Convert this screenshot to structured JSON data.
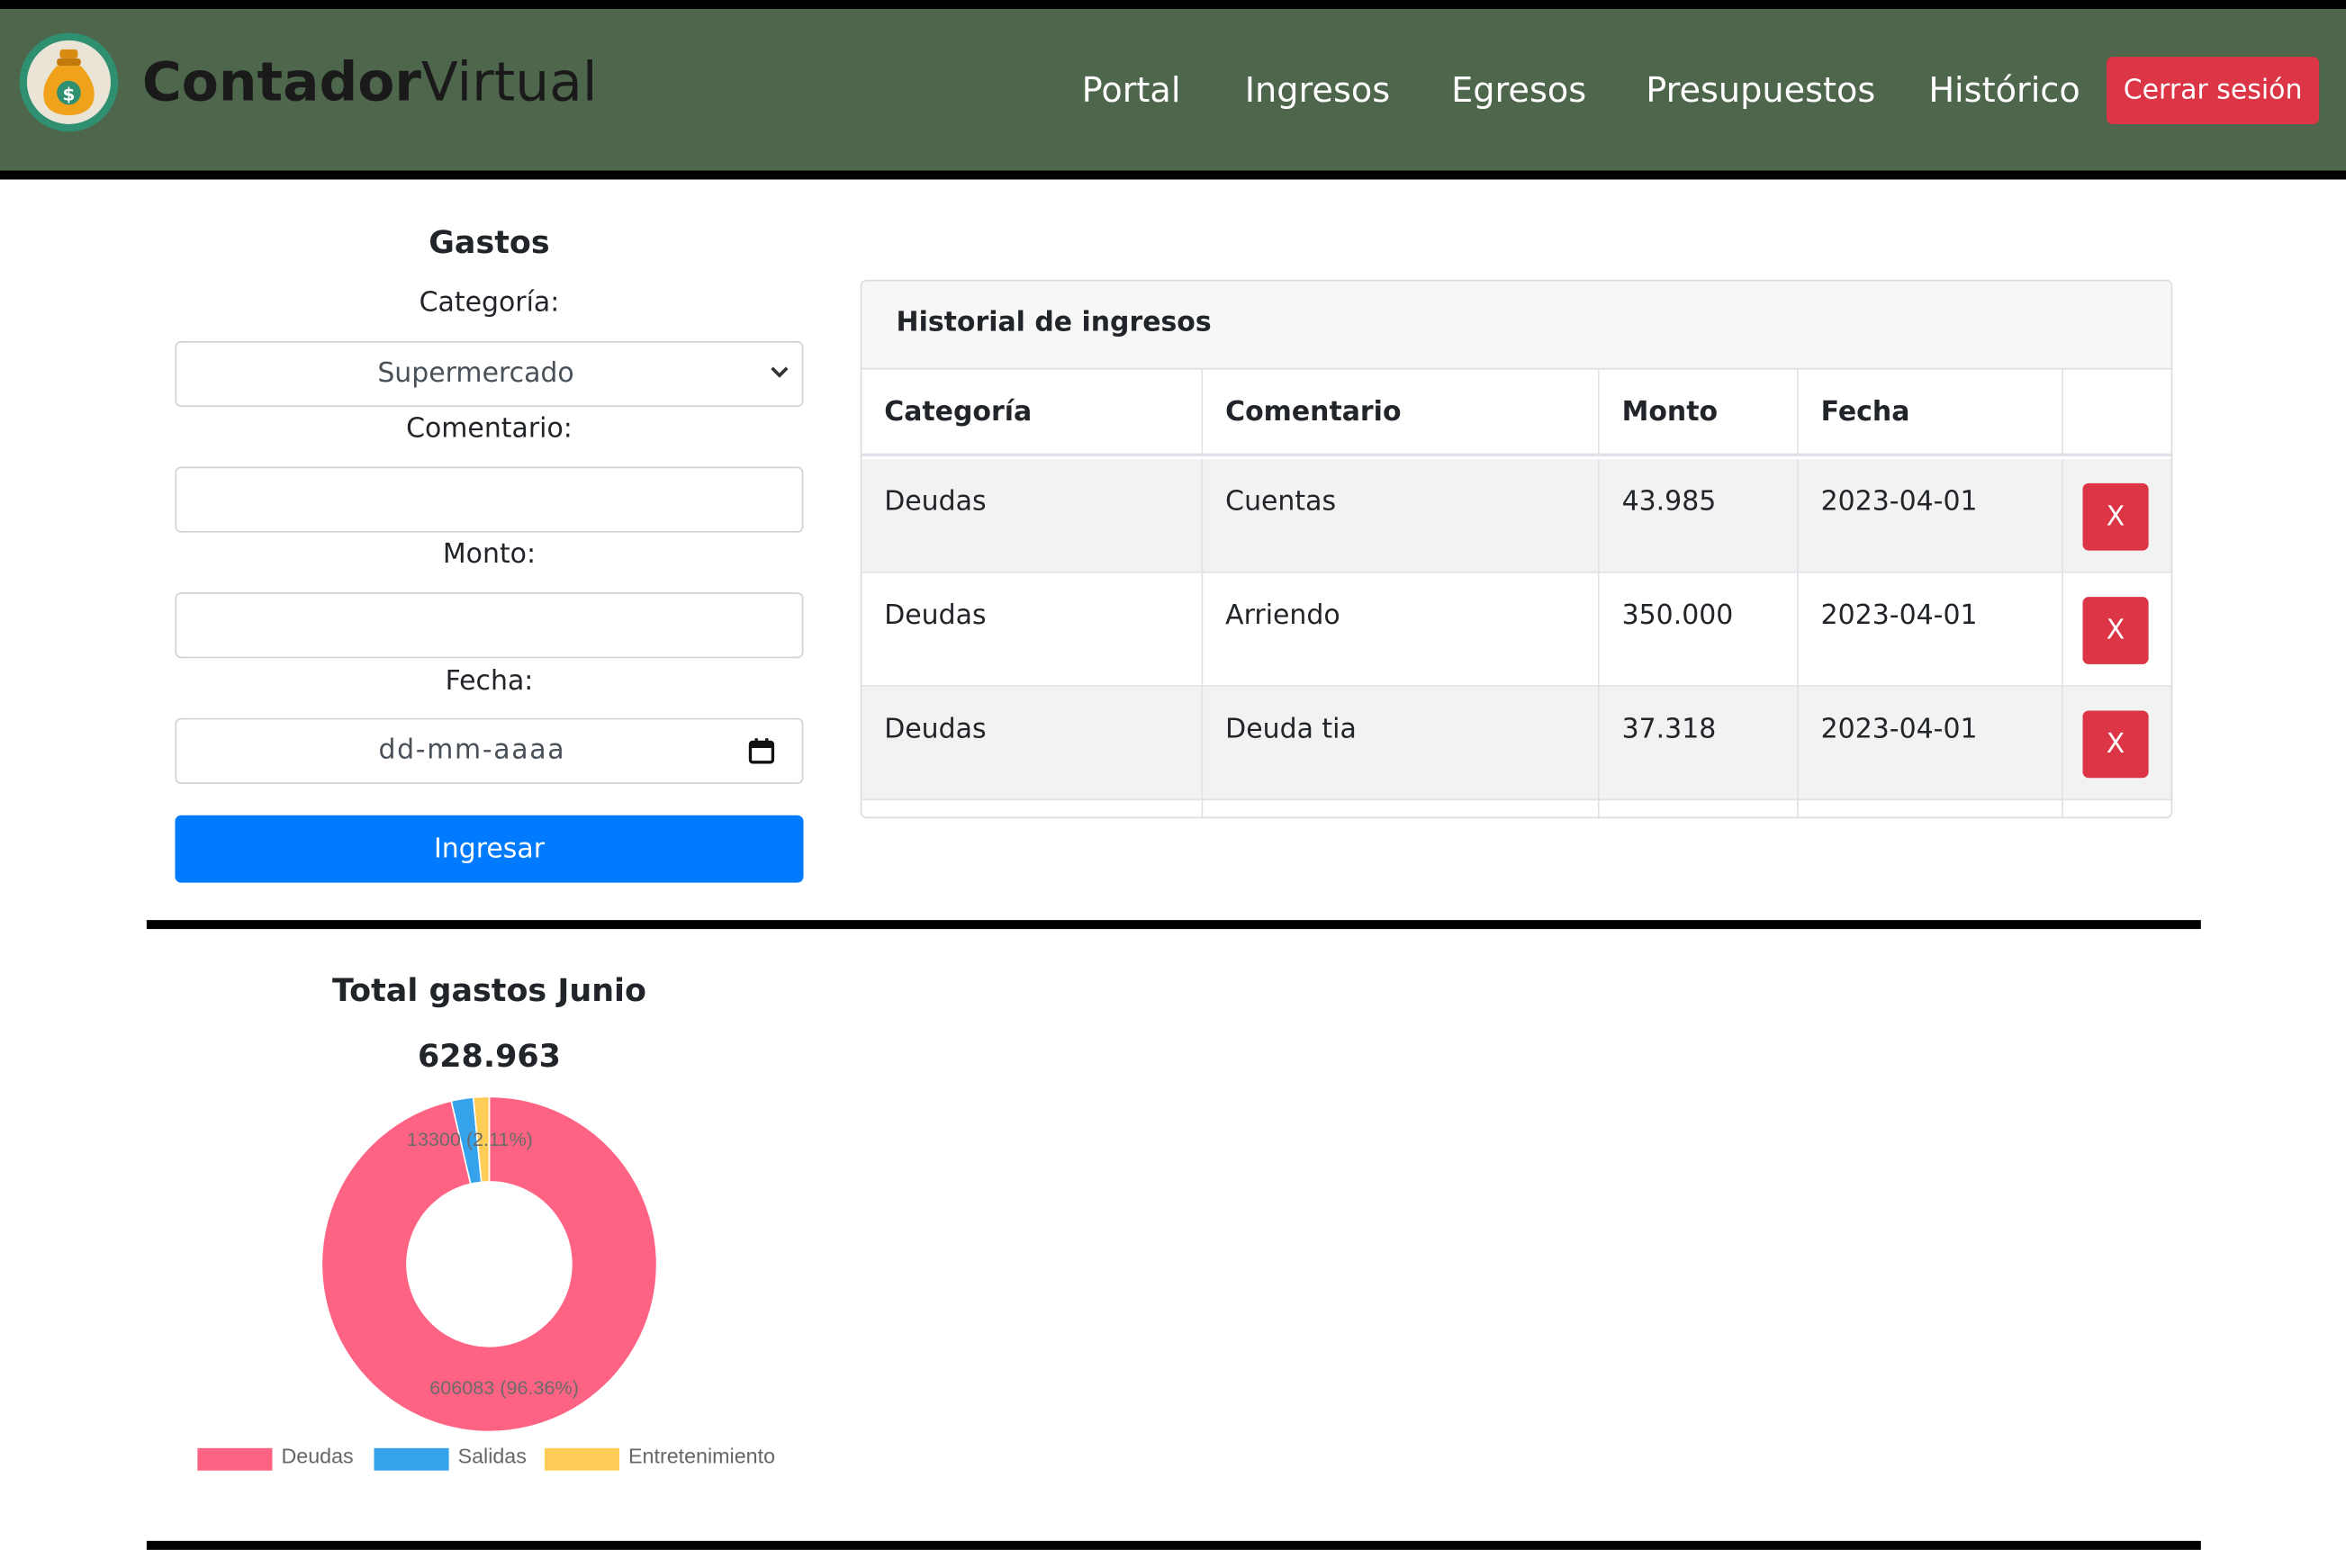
{
  "header": {
    "brand_bold": "Contador",
    "brand_light": "Virtual",
    "logo_icon": "money-bag-icon",
    "nav": [
      "Portal",
      "Ingresos",
      "Egresos",
      "Presupuestos",
      "Histórico"
    ],
    "logout_label": "Cerrar sesión"
  },
  "form": {
    "title": "Gastos",
    "category_label": "Categoría:",
    "category_value": "Supermercado",
    "comment_label": "Comentario:",
    "comment_value": "",
    "amount_label": "Monto:",
    "amount_value": "",
    "date_label": "Fecha:",
    "date_placeholder": "dd-mm-aaaa",
    "submit_label": "Ingresar"
  },
  "history": {
    "title": "Historial de ingresos",
    "columns": [
      "Categoría",
      "Comentario",
      "Monto",
      "Fecha",
      ""
    ],
    "rows": [
      {
        "category": "Deudas",
        "comment": "Cuentas",
        "amount": "43.985",
        "date": "2023-04-01",
        "action": "X"
      },
      {
        "category": "Deudas",
        "comment": "Arriendo",
        "amount": "350.000",
        "date": "2023-04-01",
        "action": "X"
      },
      {
        "category": "Deudas",
        "comment": "Deuda tia",
        "amount": "37.318",
        "date": "2023-04-01",
        "action": "X"
      }
    ]
  },
  "summary": {
    "title": "Total gastos Junio",
    "total": "628.963"
  },
  "chart_data": {
    "type": "pie",
    "donut": true,
    "categories": [
      "Deudas",
      "Salidas",
      "Entretenimiento"
    ],
    "values": [
      606083,
      13300,
      9580
    ],
    "colors": [
      "#ff6384",
      "#36a2eb",
      "#ffcd56"
    ],
    "data_labels": [
      {
        "category": "Deudas",
        "text": "606083 (96.36%)"
      },
      {
        "category": "Salidas",
        "text": "13300 (2.11%)"
      }
    ],
    "legend_position": "bottom"
  }
}
